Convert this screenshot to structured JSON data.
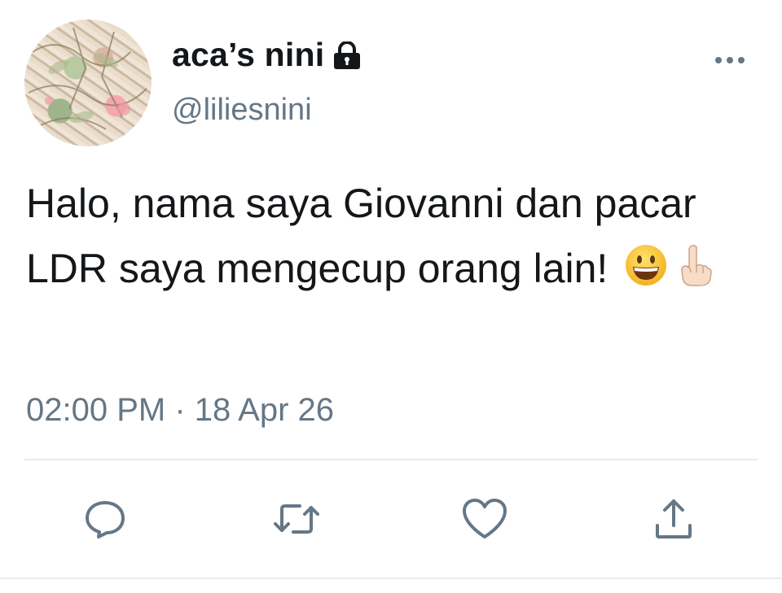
{
  "user": {
    "display_name": "aca’s nini",
    "handle": "@liliesnini",
    "protected_icon": "lock-icon",
    "avatar": "floral-fabric-avatar"
  },
  "header": {
    "more_icon": "more-dots-icon"
  },
  "tweet": {
    "text": "Halo, nama saya Giovanni dan pacar LDR saya mengecup orang lain!",
    "emojis": [
      "grinning-face-emoji",
      "pointing-up-emoji"
    ],
    "timestamp": "02:00 PM · 18 Apr 26"
  },
  "actions": [
    {
      "name": "reply",
      "icon": "reply-icon"
    },
    {
      "name": "retweet",
      "icon": "retweet-icon"
    },
    {
      "name": "like",
      "icon": "like-heart-icon"
    },
    {
      "name": "share",
      "icon": "share-icon"
    }
  ],
  "colors": {
    "text": "#14171a",
    "secondary": "#657786",
    "divider": "#e6ecf0"
  }
}
